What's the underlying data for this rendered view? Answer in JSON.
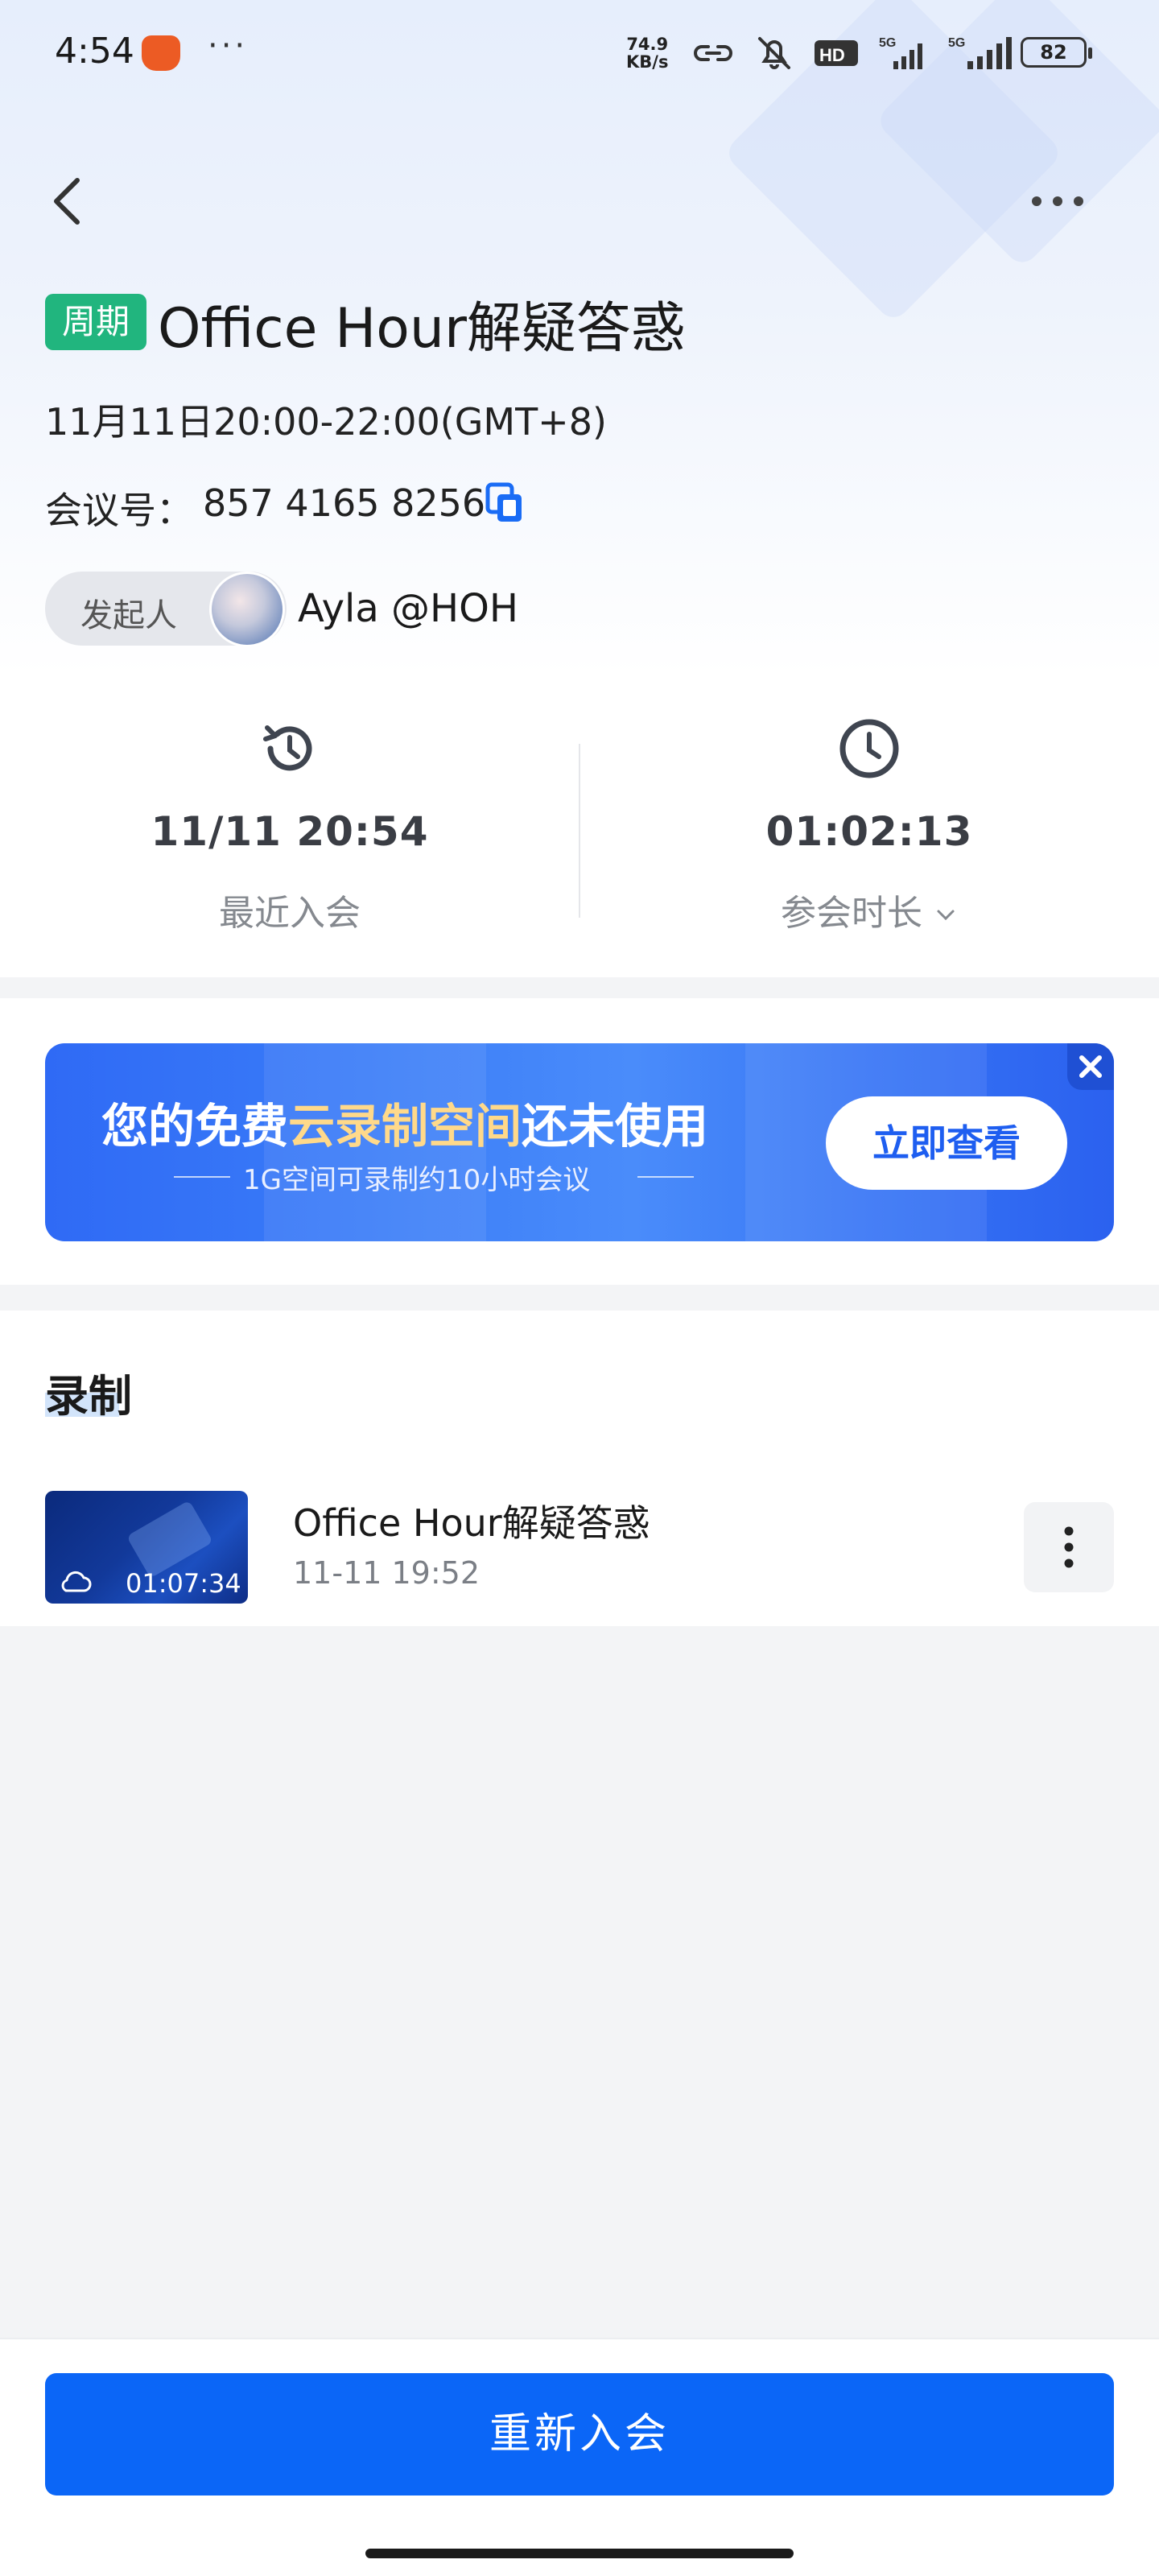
{
  "status_bar": {
    "time": "4:54",
    "dots": "···",
    "net_speed_value": "74.9",
    "net_speed_unit": "KB/s",
    "battery": "82"
  },
  "meeting": {
    "tag": "周期",
    "title": "Office Hour解疑答惑",
    "datetime": "11月11日20:00-22:00(GMT+8)",
    "number_label": "会议号：",
    "number": "857 4165 8256",
    "host_label": "发起人",
    "host_name": "Ayla @HOH"
  },
  "stats": {
    "last_join_value": "11/11 20:54",
    "last_join_label": "最近入会",
    "duration_value": "01:02:13",
    "duration_label": "参会时长"
  },
  "banner": {
    "title_part1": "您的免费",
    "title_highlight": "云录制空间",
    "title_part2": "还未使用",
    "subtitle": "1G空间可录制约10小时会议",
    "button": "立即查看"
  },
  "recordings": {
    "heading": "录制",
    "items": [
      {
        "title": "Office Hour解疑答惑",
        "date": "11-11 19:52",
        "duration": "01:07:34"
      }
    ]
  },
  "bottom": {
    "rejoin_button": "重新入会"
  },
  "colors": {
    "tag_green": "#21b57e",
    "primary_blue": "#0b66f7",
    "banner_highlight": "#ffd98a"
  }
}
